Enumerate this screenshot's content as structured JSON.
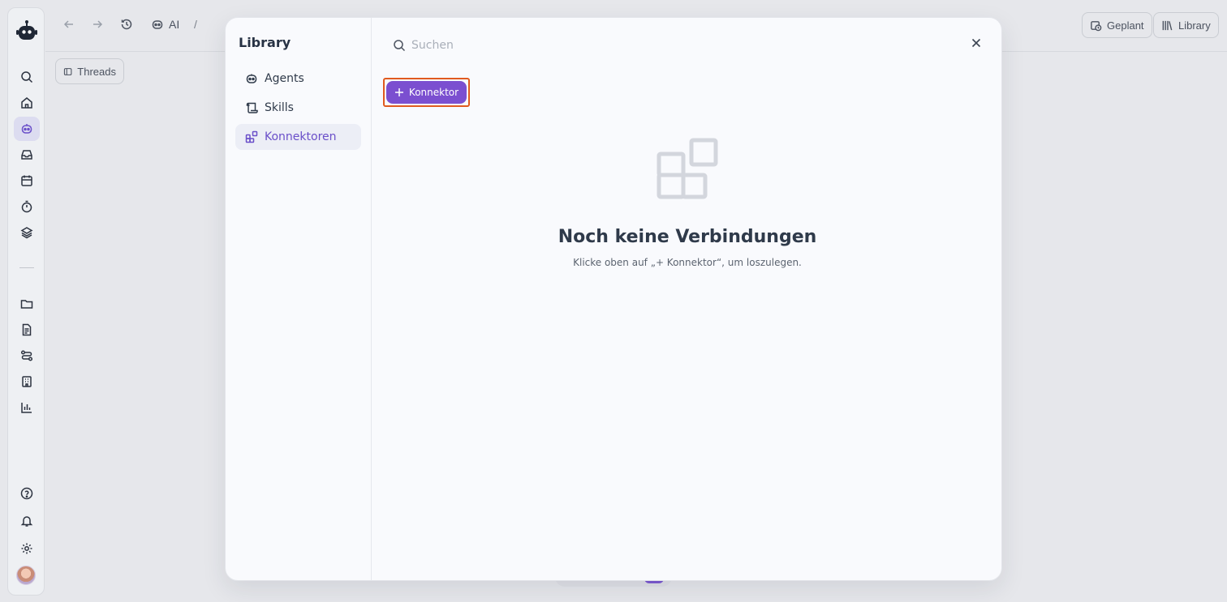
{
  "topbar": {
    "crumb_ai": "AI",
    "crumb_sep": "/",
    "geplant_label": "Geplant",
    "library_label": "Library"
  },
  "threads_label": "Threads",
  "modal": {
    "title": "Library",
    "nav": [
      {
        "label": "Agents",
        "icon": "robot-icon"
      },
      {
        "label": "Skills",
        "icon": "scroll-icon"
      },
      {
        "label": "Konnektoren",
        "icon": "grid-plus-icon",
        "active": true
      }
    ],
    "search_placeholder": "Suchen",
    "add_button_label": "Konnektor",
    "empty_title": "Noch keine Verbindungen",
    "empty_subtitle": "Klicke oben auf „+ Konnektor“, um loszulegen."
  },
  "colors": {
    "accent": "#7b4fd0",
    "highlight_border": "#e05a1f",
    "active_nav_text": "#6a4fc9"
  }
}
